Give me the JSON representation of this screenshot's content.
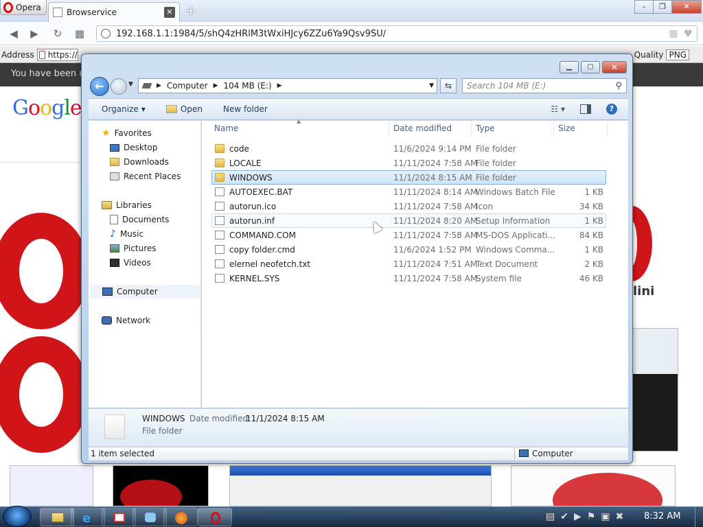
{
  "opera": {
    "menu_label": "Opera",
    "tab_title": "Browservice",
    "tab_close": "✕",
    "new_tab": "+",
    "window_buttons": [
      "–",
      "❐",
      "✕"
    ],
    "url": "192.168.1.1:1984/5/shQ4zHRlM3tWxiHJcy6ZZu6Ya9Qsv9SU/",
    "address_label": "Address",
    "address_value": "https://",
    "quality_label": "Quality",
    "quality_value": "PNG"
  },
  "page": {
    "banner_text": "You have been re",
    "google_letters": [
      {
        "ch": "G",
        "color": "#3369e8"
      },
      {
        "ch": "o",
        "color": "#d50f25"
      },
      {
        "ch": "o",
        "color": "#eeb211"
      },
      {
        "ch": "g",
        "color": "#3369e8"
      },
      {
        "ch": "l",
        "color": "#009925"
      },
      {
        "ch": "e",
        "color": "#d50f25"
      }
    ],
    "mini_text": "lini"
  },
  "explorer": {
    "breadcrumb": [
      "Computer",
      "104 MB (E:)"
    ],
    "search_placeholder": "Search 104 MB (E:)",
    "commands": {
      "organize": "Organize",
      "open": "Open",
      "new_folder": "New folder"
    },
    "nav": {
      "favorites": "Favorites",
      "favorites_items": [
        "Desktop",
        "Downloads",
        "Recent Places"
      ],
      "libraries": "Libraries",
      "libraries_items": [
        "Documents",
        "Music",
        "Pictures",
        "Videos"
      ],
      "computer": "Computer",
      "network": "Network"
    },
    "columns": {
      "name": "Name",
      "date": "Date modified",
      "type": "Type",
      "size": "Size"
    },
    "files": [
      {
        "name": "code",
        "date": "11/6/2024 9:14 PM",
        "type": "File folder",
        "size": "",
        "kind": "folder"
      },
      {
        "name": "LOCALE",
        "date": "11/11/2024 7:58 AM",
        "type": "File folder",
        "size": "",
        "kind": "folder"
      },
      {
        "name": "WINDOWS",
        "date": "11/1/2024 8:15 AM",
        "type": "File folder",
        "size": "",
        "kind": "folder"
      },
      {
        "name": "AUTOEXEC.BAT",
        "date": "11/11/2024 8:14 AM",
        "type": "Windows Batch File",
        "size": "1 KB",
        "kind": "file"
      },
      {
        "name": "autorun.ico",
        "date": "11/11/2024 7:58 AM",
        "type": "Icon",
        "size": "34 KB",
        "kind": "file"
      },
      {
        "name": "autorun.inf",
        "date": "11/11/2024 8:20 AM",
        "type": "Setup Information",
        "size": "1 KB",
        "kind": "file"
      },
      {
        "name": "COMMAND.COM",
        "date": "11/11/2024 7:58 AM",
        "type": "MS-DOS Applicati...",
        "size": "84 KB",
        "kind": "file"
      },
      {
        "name": "copy folder.cmd",
        "date": "11/6/2024 1:52 PM",
        "type": "Windows Comma...",
        "size": "1 KB",
        "kind": "file"
      },
      {
        "name": "elernel neofetch.txt",
        "date": "11/11/2024 7:51 AM",
        "type": "Text Document",
        "size": "2 KB",
        "kind": "file"
      },
      {
        "name": "KERNEL.SYS",
        "date": "11/11/2024 7:58 AM",
        "type": "System file",
        "size": "46 KB",
        "kind": "file"
      }
    ],
    "details": {
      "name": "WINDOWS",
      "date_label": "Date modified:",
      "date_value": "11/1/2024 8:15 AM",
      "type": "File folder"
    },
    "status": {
      "selected": "1 item selected",
      "location": "Computer"
    }
  },
  "taskbar": {
    "clock": "8:32 AM"
  },
  "colors": {
    "accent": "#3399ff",
    "opera_red": "#d01519",
    "selection_border": "#84acdd"
  }
}
